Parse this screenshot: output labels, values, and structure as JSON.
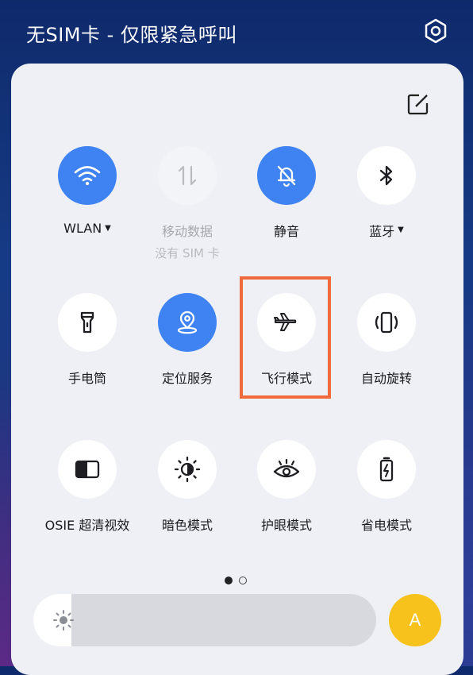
{
  "status": {
    "title": "无SIM卡 - 仅限紧急呼叫"
  },
  "icons": {
    "settings": "gear-icon",
    "edit": "edit-icon"
  },
  "colors": {
    "accent": "#3f82f2",
    "highlight": "#f06a3c",
    "auto": "#f6c21b"
  },
  "tiles": [
    {
      "label": "WLAN",
      "sub": "",
      "state": "on",
      "icon": "wifi-icon",
      "dropdown": true
    },
    {
      "label": "移动数据",
      "sub": "没有 SIM 卡",
      "state": "disabled",
      "icon": "mobile-data-icon",
      "dropdown": false
    },
    {
      "label": "静音",
      "sub": "",
      "state": "on",
      "icon": "bell-off-icon",
      "dropdown": false
    },
    {
      "label": "蓝牙",
      "sub": "",
      "state": "off",
      "icon": "bluetooth-icon",
      "dropdown": true
    },
    {
      "label": "手电筒",
      "sub": "",
      "state": "off",
      "icon": "flashlight-icon",
      "dropdown": false
    },
    {
      "label": "定位服务",
      "sub": "",
      "state": "on",
      "icon": "location-icon",
      "dropdown": false
    },
    {
      "label": "飞行模式",
      "sub": "",
      "state": "off",
      "icon": "airplane-icon",
      "dropdown": false
    },
    {
      "label": "自动旋转",
      "sub": "",
      "state": "off",
      "icon": "auto-rotate-icon",
      "dropdown": false
    },
    {
      "label": "OSIE 超清视效",
      "sub": "",
      "state": "off",
      "icon": "osie-icon",
      "dropdown": false
    },
    {
      "label": "暗色模式",
      "sub": "",
      "state": "off",
      "icon": "dark-mode-icon",
      "dropdown": false
    },
    {
      "label": "护眼模式",
      "sub": "",
      "state": "off",
      "icon": "eye-icon",
      "dropdown": false
    },
    {
      "label": "省电模式",
      "sub": "",
      "state": "off",
      "icon": "battery-saver-icon",
      "dropdown": false
    }
  ],
  "pager": {
    "current": 1,
    "total": 2
  },
  "brightness": {
    "level": 0.0,
    "icon": "sun-icon"
  },
  "auto_brightness": {
    "label": "A"
  }
}
